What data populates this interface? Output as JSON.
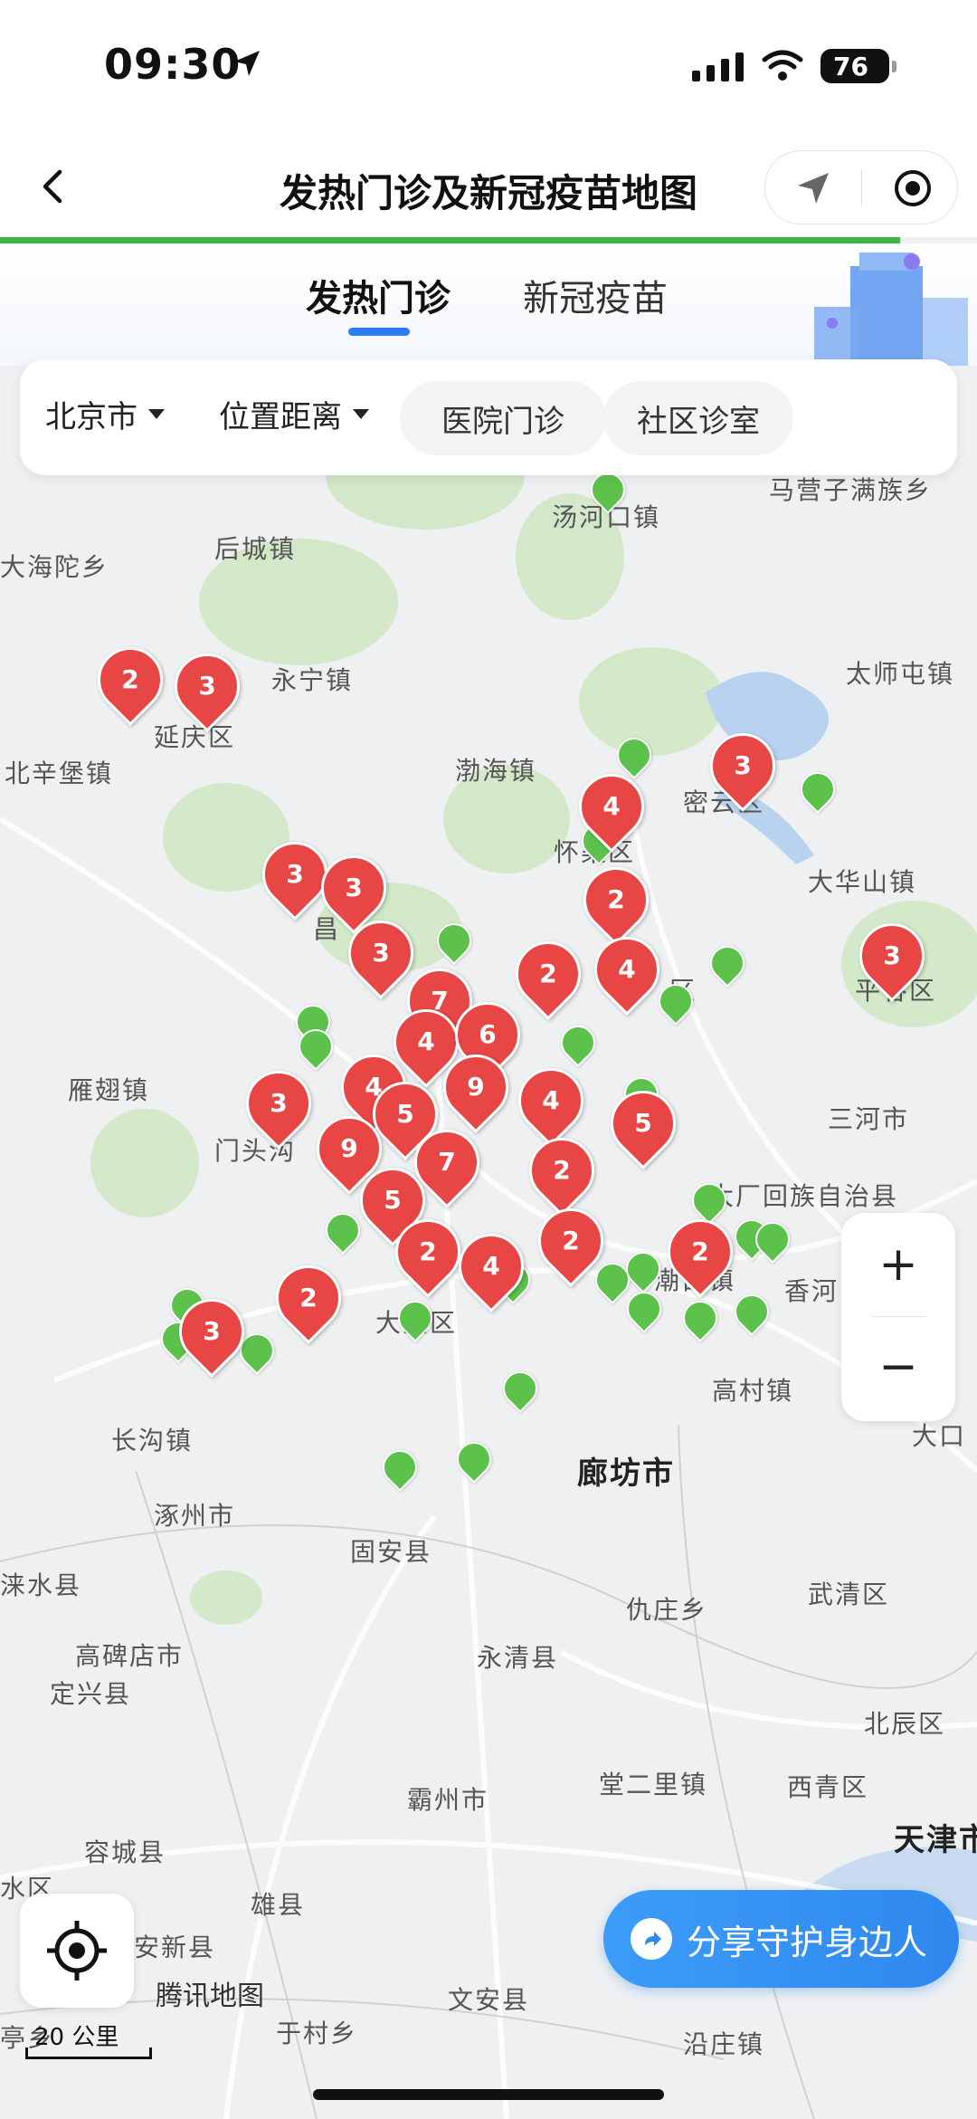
{
  "status_bar": {
    "time": "09:30",
    "battery": "76"
  },
  "header": {
    "title": "发热门诊及新冠疫苗地图"
  },
  "tabs": [
    {
      "label": "发热门诊"
    },
    {
      "label": "新冠疫苗"
    }
  ],
  "filters": {
    "city": "北京市",
    "distance": "位置距离",
    "chip_hospital": "医院门诊",
    "chip_community": "社区诊室"
  },
  "map": {
    "places": [
      {
        "t": "汤河口镇"
      },
      {
        "t": "马营子满族乡"
      },
      {
        "t": "后城镇"
      },
      {
        "t": "大海陀乡"
      },
      {
        "t": "永宁镇"
      },
      {
        "t": "太师屯镇"
      },
      {
        "t": "延庆区"
      },
      {
        "t": "北辛堡镇"
      },
      {
        "t": "渤海镇"
      },
      {
        "t": "密云区"
      },
      {
        "t": "怀柔区"
      },
      {
        "t": "大华山镇"
      },
      {
        "t": "昌"
      },
      {
        "t": "平谷区"
      },
      {
        "t": "区"
      },
      {
        "t": "雁翅镇"
      },
      {
        "t": "三河市"
      },
      {
        "t": "门头沟"
      },
      {
        "t": "大厂回族自治县"
      },
      {
        "t": "区"
      },
      {
        "t": "大兴区"
      },
      {
        "t": "潮白镇"
      },
      {
        "t": "香河"
      },
      {
        "t": "长沟镇"
      },
      {
        "t": "高村镇"
      },
      {
        "t": "大口"
      },
      {
        "t": "廊坊市"
      },
      {
        "t": "涿州市"
      },
      {
        "t": "固安县"
      },
      {
        "t": "涞水县"
      },
      {
        "t": "武清区"
      },
      {
        "t": "仇庄乡"
      },
      {
        "t": "高碑店市"
      },
      {
        "t": "永清县"
      },
      {
        "t": "定兴县"
      },
      {
        "t": "北辰区"
      },
      {
        "t": "堂二里镇"
      },
      {
        "t": "霸州市"
      },
      {
        "t": "西青区"
      },
      {
        "t": "天津市"
      },
      {
        "t": "容城县"
      },
      {
        "t": "水区"
      },
      {
        "t": "雄县"
      },
      {
        "t": "安新县"
      },
      {
        "t": "文安县"
      },
      {
        "t": "亭乡"
      },
      {
        "t": "于村乡"
      },
      {
        "t": "沿庄镇"
      }
    ],
    "red_markers": [
      {
        "n": "2"
      },
      {
        "n": "3"
      },
      {
        "n": "3"
      },
      {
        "n": "4"
      },
      {
        "n": "3"
      },
      {
        "n": "3"
      },
      {
        "n": "2"
      },
      {
        "n": "3"
      },
      {
        "n": "3"
      },
      {
        "n": "2"
      },
      {
        "n": "4"
      },
      {
        "n": "7"
      },
      {
        "n": "4"
      },
      {
        "n": "6"
      },
      {
        "n": "4"
      },
      {
        "n": "9"
      },
      {
        "n": "3"
      },
      {
        "n": "5"
      },
      {
        "n": "4"
      },
      {
        "n": "5"
      },
      {
        "n": "9"
      },
      {
        "n": "7"
      },
      {
        "n": "2"
      },
      {
        "n": "5"
      },
      {
        "n": "2"
      },
      {
        "n": "4"
      },
      {
        "n": "2"
      },
      {
        "n": "2"
      },
      {
        "n": "2"
      },
      {
        "n": "3"
      }
    ],
    "brand": "腾讯地图",
    "scale": "20 公里"
  },
  "controls": {
    "zoom_in": "+",
    "zoom_out": "−",
    "share": "分享守护身边人"
  },
  "colors": {
    "accent_blue": "#2b7cf6",
    "progress_green": "#3cb84a",
    "marker_red": "#e84545",
    "marker_green": "#5cc24c"
  }
}
